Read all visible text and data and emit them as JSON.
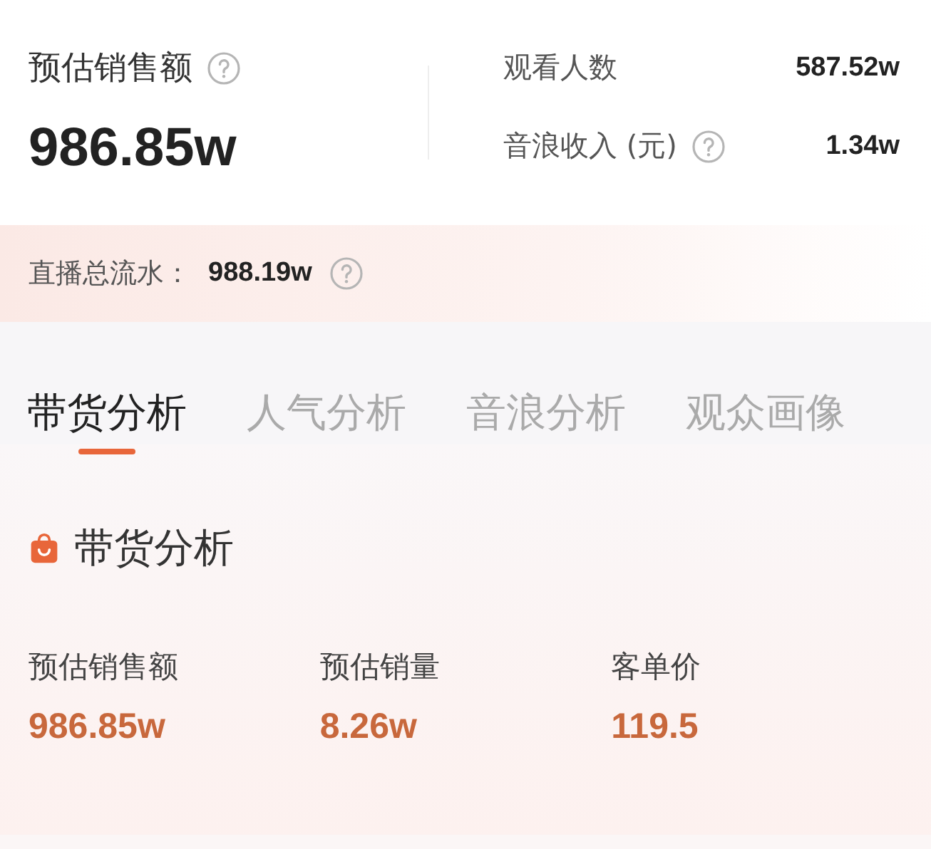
{
  "summary": {
    "sales_label": "预估销售额",
    "sales_value": "986.85w",
    "stats": [
      {
        "label": "观看人数",
        "value": "587.52w",
        "help": false
      },
      {
        "label": "音浪收入 (元)",
        "value": "1.34w",
        "help": true
      }
    ]
  },
  "flow": {
    "label": "直播总流水：",
    "value": "988.19w"
  },
  "tabs": [
    {
      "label": "带货分析",
      "selected": true
    },
    {
      "label": "人气分析",
      "selected": false
    },
    {
      "label": "音浪分析",
      "selected": false
    },
    {
      "label": "观众画像",
      "selected": false
    }
  ],
  "section": {
    "title": "带货分析",
    "metrics": [
      {
        "label": "预估销售额",
        "value": "986.85w"
      },
      {
        "label": "预估销量",
        "value": "8.26w"
      },
      {
        "label": "客单价",
        "value": "119.5"
      }
    ]
  }
}
